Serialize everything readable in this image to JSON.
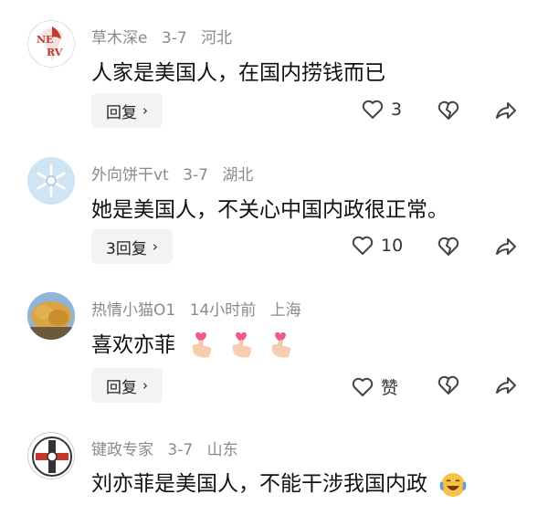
{
  "comments": [
    {
      "user": "草木深e",
      "date": "3-7",
      "location": "河北",
      "text": "人家是美国人，在国内捞钱而已",
      "reply_label": "回复",
      "like_count": "3",
      "avatar_text": "NERV"
    },
    {
      "user": "外向饼干vt",
      "date": "3-7",
      "location": "湖北",
      "text": "她是美国人，不关心中国内政很正常。",
      "reply_label": "3回复",
      "like_count": "10"
    },
    {
      "user": "热情小猫O1",
      "date": "14小时前",
      "location": "上海",
      "text": "喜欢亦菲",
      "reply_label": "回复",
      "like_count": "赞"
    },
    {
      "user": "键政专家",
      "date": "3-7",
      "location": "山东",
      "text": "刘亦菲是美国人，不能干涉我国内政"
    }
  ],
  "icons": {
    "like": "heart-outline-icon",
    "dislike": "broken-heart-icon",
    "share": "share-arrow-icon",
    "chevron": "chevron-right-icon"
  }
}
